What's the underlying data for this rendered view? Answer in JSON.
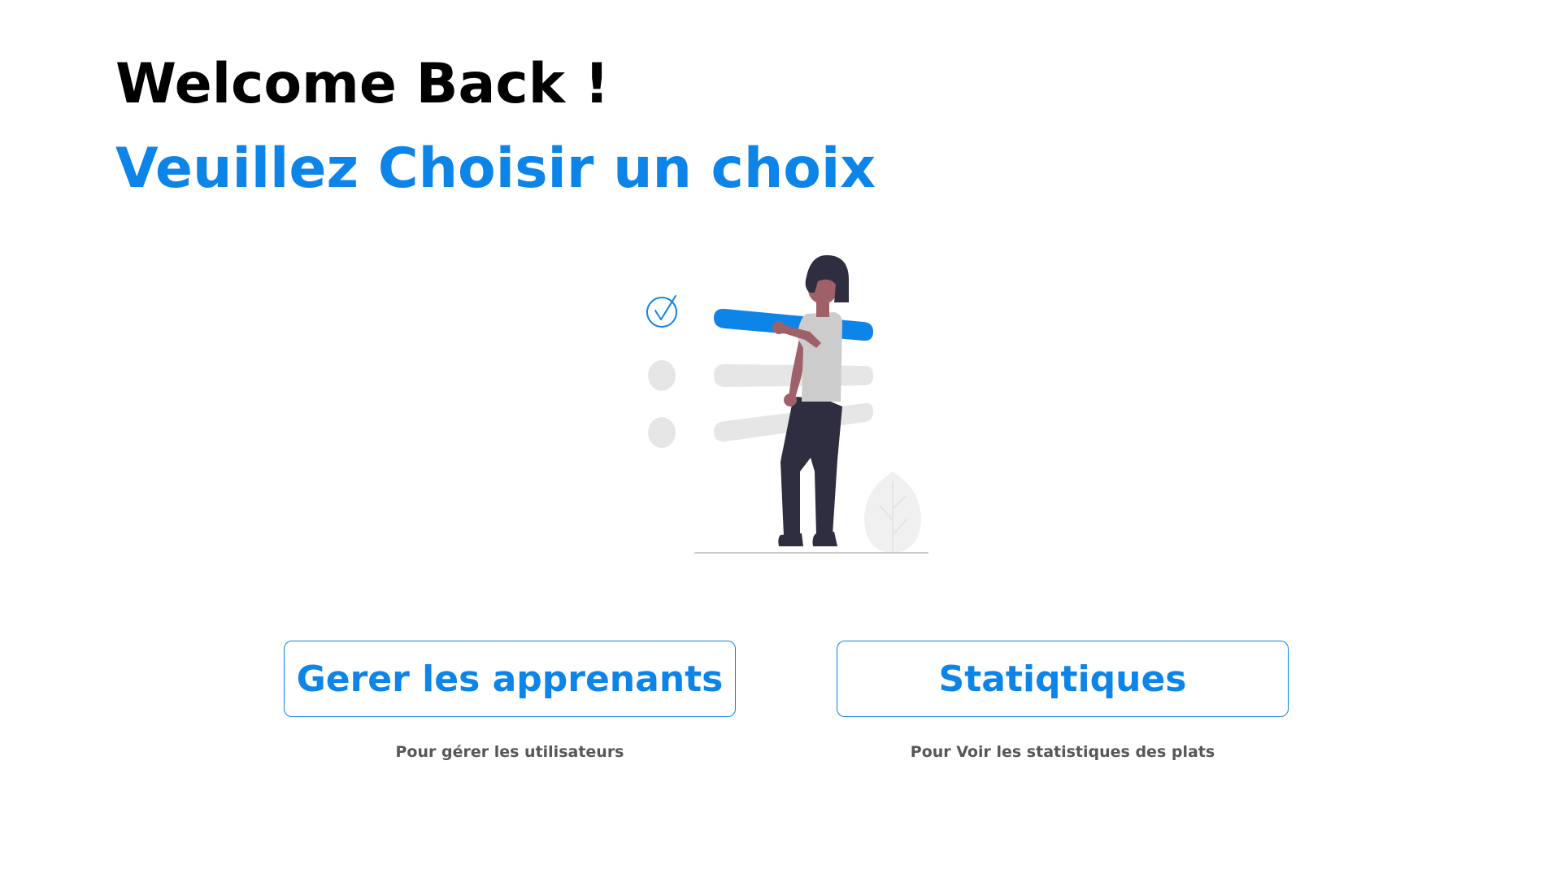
{
  "header": {
    "title": "Welcome Back !",
    "subtitle": "Veuillez Choisir un choix"
  },
  "illustration": {
    "icon": "woman-checklist-illustration",
    "accent_color": "#0d84e8",
    "skin_color": "#9e616a",
    "dark_color": "#2f2e41",
    "shirt_color": "#cccccc",
    "light_gray": "#e6e6e6"
  },
  "choices": [
    {
      "label": "Gerer les apprenants",
      "description": "Pour gérer les utilisateurs"
    },
    {
      "label": "Statiqtiques",
      "description": "Pour Voir les statistiques des plats"
    }
  ],
  "colors": {
    "accent": "#0d84e8",
    "title": "#000000",
    "description": "#575757",
    "background": "#ffffff"
  }
}
